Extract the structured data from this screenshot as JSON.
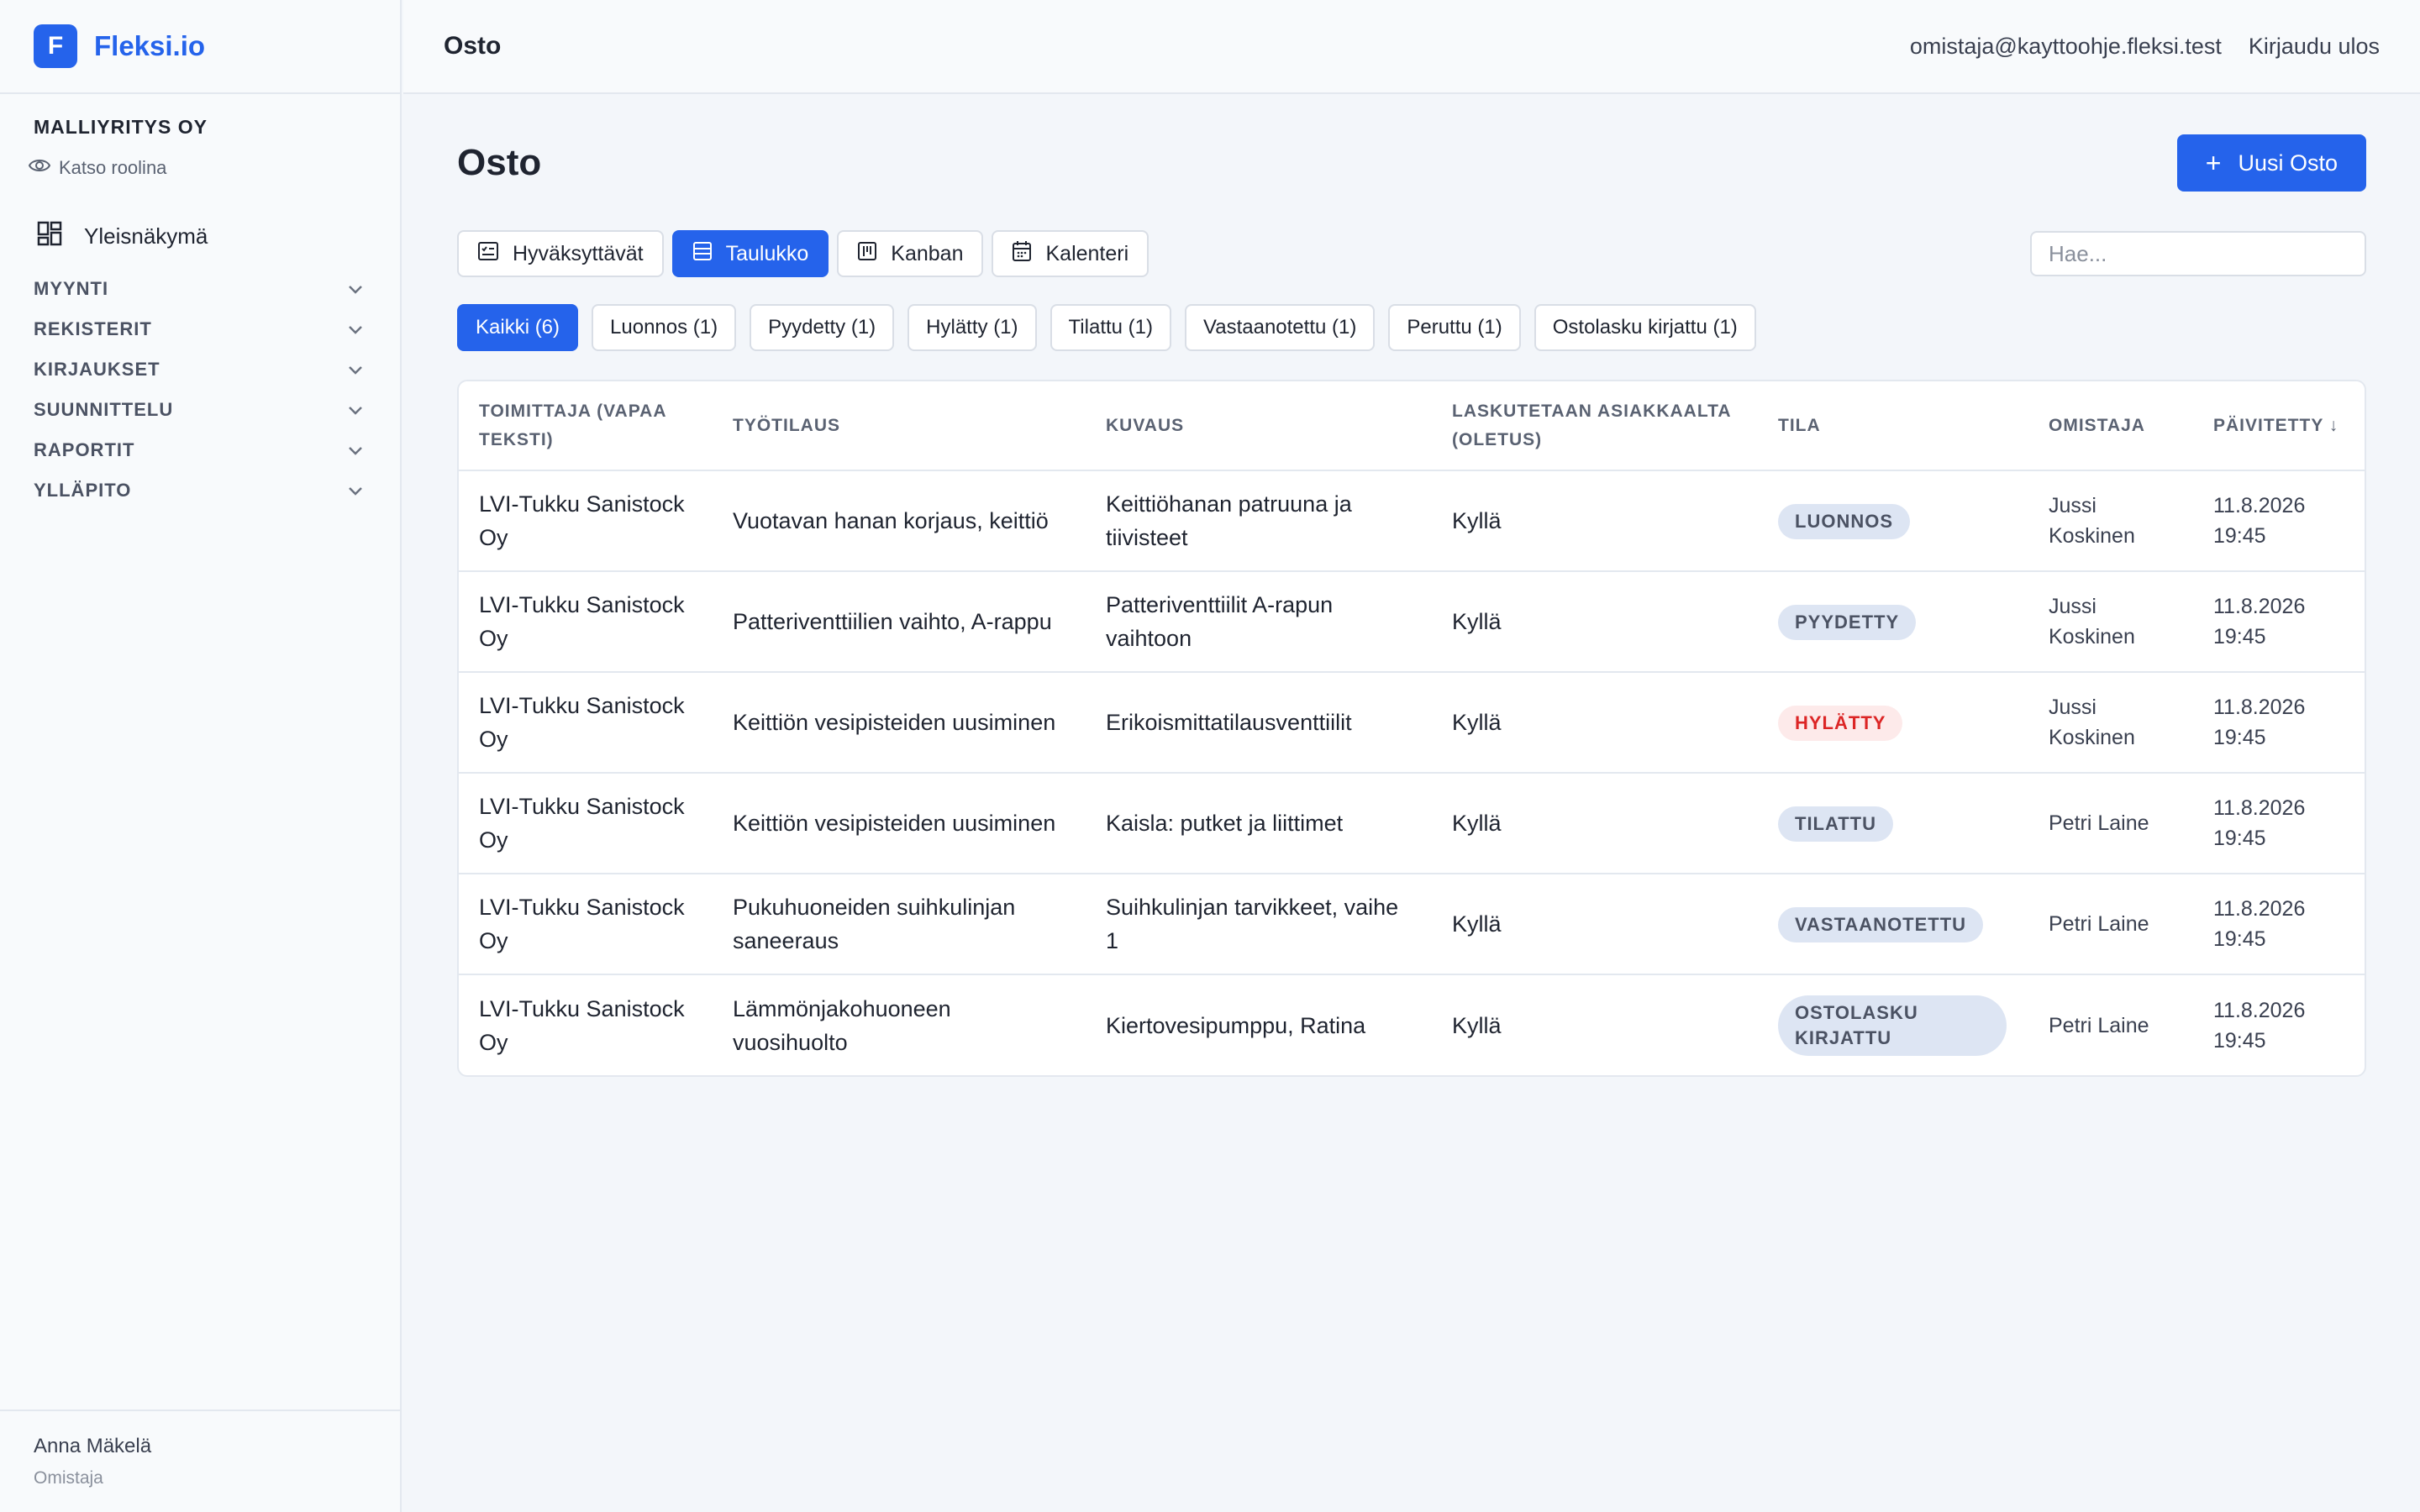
{
  "brand": {
    "logo_letter": "F",
    "name": "Fleksi.io"
  },
  "sidebar": {
    "company": "MALLIYRITYS OY",
    "role_view": "Katso roolina",
    "overview": "Yleisnäkymä",
    "sections": [
      "MYYNTI",
      "REKISTERIT",
      "KIRJAUKSET",
      "SUUNNITTELU",
      "RAPORTIT",
      "YLLÄPITO"
    ],
    "user": {
      "name": "Anna Mäkelä",
      "role": "Omistaja"
    }
  },
  "topbar": {
    "title": "Osto",
    "email": "omistaja@kayttoohje.fleksi.test",
    "logout": "Kirjaudu ulos"
  },
  "page": {
    "title": "Osto",
    "new_button": "Uusi Osto",
    "new_button_icon": "+",
    "search_placeholder": "Hae..."
  },
  "views": [
    {
      "label": "Hyväksyttävät",
      "icon": "approval-icon",
      "active": false
    },
    {
      "label": "Taulukko",
      "icon": "table-icon",
      "active": true
    },
    {
      "label": "Kanban",
      "icon": "kanban-icon",
      "active": false
    },
    {
      "label": "Kalenteri",
      "icon": "calendar-icon",
      "active": false
    }
  ],
  "filters": [
    {
      "label": "Kaikki (6)",
      "active": true
    },
    {
      "label": "Luonnos (1)",
      "active": false
    },
    {
      "label": "Pyydetty (1)",
      "active": false
    },
    {
      "label": "Hylätty (1)",
      "active": false
    },
    {
      "label": "Tilattu (1)",
      "active": false
    },
    {
      "label": "Vastaanotettu (1)",
      "active": false
    },
    {
      "label": "Peruttu (1)",
      "active": false
    },
    {
      "label": "Ostolasku kirjattu (1)",
      "active": false
    }
  ],
  "table": {
    "columns": [
      "TOIMITTAJA (VAPAA TEKSTI)",
      "TYÖTILAUS",
      "KUVAUS",
      "LASKUTETAAN ASIAKKAALTA (OLETUS)",
      "TILA",
      "OMISTAJA",
      "PÄIVITETTY ↓"
    ],
    "rows": [
      {
        "supplier": "LVI-Tukku Sanistock Oy",
        "work_order": "Vuotavan hanan korjaus, keittiö",
        "description": "Keittiöhanan patruuna ja tiivisteet",
        "billed": "Kyllä",
        "status": "LUONNOS",
        "owner": "Jussi Koskinen",
        "updated": "11.8.2026 19:45"
      },
      {
        "supplier": "LVI-Tukku Sanistock Oy",
        "work_order": "Patteriventtiilien vaihto, A-rappu",
        "description": "Patteriventtiilit A-rapun vaihtoon",
        "billed": "Kyllä",
        "status": "PYYDETTY",
        "owner": "Jussi Koskinen",
        "updated": "11.8.2026 19:45"
      },
      {
        "supplier": "LVI-Tukku Sanistock Oy",
        "work_order": "Keittiön vesipisteiden uusiminen",
        "description": "Erikoismittatilausventtiilit",
        "billed": "Kyllä",
        "status": "HYLÄTTY",
        "owner": "Jussi Koskinen",
        "updated": "11.8.2026 19:45"
      },
      {
        "supplier": "LVI-Tukku Sanistock Oy",
        "work_order": "Keittiön vesipisteiden uusiminen",
        "description": "Kaisla: putket ja liittimet",
        "billed": "Kyllä",
        "status": "TILATTU",
        "owner": "Petri Laine",
        "updated": "11.8.2026 19:45"
      },
      {
        "supplier": "LVI-Tukku Sanistock Oy",
        "work_order": "Pukuhuoneiden suihkulinjan saneeraus",
        "description": "Suihkulinjan tarvikkeet, vaihe 1",
        "billed": "Kyllä",
        "status": "VASTAANOTETTU",
        "owner": "Petri Laine",
        "updated": "11.8.2026 19:45"
      },
      {
        "supplier": "LVI-Tukku Sanistock Oy",
        "work_order": "Lämmönjakohuoneen vuosihuolto",
        "description": "Kiertovesipumppu, Ratina",
        "billed": "Kyllä",
        "status": "OSTOLASKU KIRJATTU",
        "owner": "Petri Laine",
        "updated": "11.8.2026 19:45"
      }
    ]
  },
  "colors": {
    "accent": "#2563eb",
    "danger": "#dc2626",
    "badge_bg": "#dde5f3",
    "badge_danger_bg": "#fdeaea"
  }
}
